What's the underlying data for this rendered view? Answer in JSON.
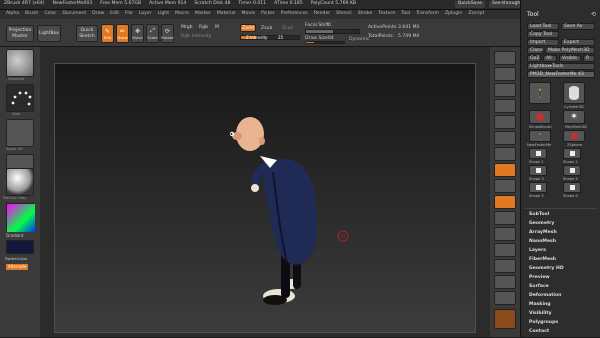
{
  "title_bar": {
    "app": "ZBrush 4R7 (x64)",
    "doc": "NewFosterMe003",
    "free_mem": "Free Mem 5.67GB",
    "active_mem": "Active Mem 914",
    "scratch": "Scratch Disk 48",
    "timer": "Timer 0.011",
    "atime": "ATime 0.185",
    "polycount": "PolyCount 5,769 KB",
    "quicksave": "QuickSave",
    "seethrough": "See-through 0",
    "menus_btn": "Menus",
    "default_script": "DefaultZScript"
  },
  "menu_bar": [
    "Alpha",
    "Brush",
    "Color",
    "Document",
    "Draw",
    "Edit",
    "File",
    "Layer",
    "Light",
    "Macro",
    "Marker",
    "Material",
    "Movie",
    "Picker",
    "Preferences",
    "Render",
    "Stencil",
    "Stroke",
    "Texture",
    "Tool",
    "Transform",
    "Zplugin",
    "Zscript"
  ],
  "top_shelf": {
    "projection_master": "Projection Master",
    "lightbox": "LightBox",
    "quick_sketch": "Quick Sketch",
    "edit": "Edit",
    "draw": "Draw",
    "move": "Move",
    "scale": "Scale",
    "rotate": "Rotate",
    "mrgb": "Mrgb",
    "rgb": "Rgb",
    "m": "M",
    "rgb_intensity": "Rgb Intensity",
    "zadd": "Zadd",
    "zsub": "Zsub",
    "zcut": "Zcut",
    "z_intensity_label": "Z Intensity",
    "z_intensity": "25",
    "focal_shift_label": "Focal Shift",
    "focal_shift": "0",
    "draw_size_label": "Draw Size",
    "draw_size": "64",
    "dynamic": "Dynamic",
    "active_points_label": "ActivePoints:",
    "active_points": "3.641 Mil",
    "total_points_label": "TotalPoints:",
    "total_points": "5.749 Mil"
  },
  "left_shelf": {
    "standard": "Standard",
    "dots": "Dots",
    "alpha_off": "Alpha Off",
    "texture_off": "Texture Off",
    "matcap": "MatCap Gray",
    "gradient": "Gradient",
    "switch_color": "SwitchColor",
    "alternate": "Alternate"
  },
  "right_shelf": [
    "BPR",
    "SPix 3",
    "Scroll",
    "Zoom",
    "Actual",
    "AAHalf",
    "Persp",
    "Floor",
    "Local",
    "L.Sym",
    "Frame",
    "Move",
    "Scale",
    "Rotate",
    "Line Fill",
    "Transp",
    "Ghost",
    "Solo",
    "Xpose"
  ],
  "tray": {
    "title": "Tool",
    "load_tool": "Load Tool",
    "save_as": "Save As",
    "copy_tool": "Copy Tool",
    "import": "Import",
    "export": "Export",
    "clone": "Clone",
    "make_polymesh": "Make PolyMesh3D",
    "goz": "GoZ",
    "all": "All",
    "visible": "Visible",
    "r": "R",
    "lightbox_tools": "Lightbox▸Tools",
    "current_tool": "PM3D_NewFosterMe 43",
    "tools": [
      {
        "label": "PM3D_NewFos",
        "icon": "figure-icon"
      },
      {
        "label": "Cylinder3D",
        "icon": "cylinder-icon"
      },
      {
        "label": "PolyMesh3D",
        "icon": "star-icon"
      },
      {
        "label": "SimpleBrush",
        "icon": "brush-icon"
      },
      {
        "label": "ZSphere",
        "icon": "zsphere-icon"
      },
      {
        "label": "NewFosterMe",
        "icon": "figure-icon"
      },
      {
        "label": "Shape 1",
        "icon": "shape-icon"
      },
      {
        "label": "Shape 2",
        "icon": "shape-icon"
      },
      {
        "label": "Shape 3",
        "icon": "shape-icon"
      },
      {
        "label": "Shape 4",
        "icon": "shape-icon"
      },
      {
        "label": "Shape 5",
        "icon": "shape-icon"
      },
      {
        "label": "Shape 6",
        "icon": "shape-icon"
      },
      {
        "label": "Shape 7",
        "icon": "shape-icon"
      },
      {
        "label": "Shape 8",
        "icon": "shape-icon"
      }
    ],
    "subpalettes": [
      "SubTool",
      "Geometry",
      "ArrayMesh",
      "NanoMesh",
      "Layers",
      "FiberMesh",
      "Geometry HD",
      "Preview",
      "Surface",
      "Deformation",
      "Masking",
      "Visibility",
      "Polygroups",
      "Contact"
    ]
  },
  "colors": {
    "accent_orange": "#e07a22",
    "suit": "#1c2340",
    "skin": "#e8b491"
  }
}
